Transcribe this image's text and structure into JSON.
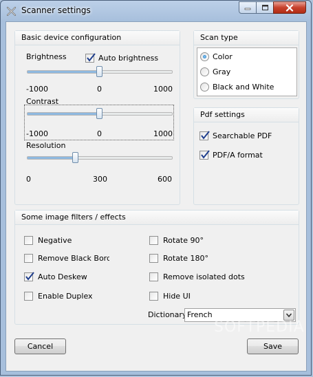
{
  "window": {
    "title": "Scanner settings"
  },
  "basic": {
    "heading": "Basic device configuration",
    "brightness": {
      "label": "Brightness",
      "min": "-1000",
      "mid": "0",
      "max": "1000",
      "value": 0,
      "range": [
        -1000,
        1000
      ]
    },
    "auto_brightness": {
      "label": "Auto brightness",
      "checked": true
    },
    "contrast": {
      "label": "Contrast",
      "min": "-1000",
      "mid": "0",
      "max": "1000",
      "value": 0,
      "range": [
        -1000,
        1000
      ]
    },
    "resolution": {
      "label": "Resolution",
      "min": "0",
      "mid": "300",
      "max": "600",
      "value": 200,
      "range": [
        0,
        600
      ]
    }
  },
  "scan_type": {
    "heading": "Scan type",
    "options": [
      {
        "label": "Color",
        "selected": true
      },
      {
        "label": "Gray",
        "selected": false
      },
      {
        "label": "Black and White",
        "selected": false
      }
    ]
  },
  "pdf": {
    "heading": "Pdf settings",
    "options": [
      {
        "label": "Searchable PDF",
        "checked": true
      },
      {
        "label": "PDF/A format",
        "checked": true
      }
    ]
  },
  "filters": {
    "heading": "Some image filters / effects",
    "left": [
      {
        "label": "Negative",
        "checked": false
      },
      {
        "label": "Remove Black Border:",
        "checked": false
      },
      {
        "label": "Auto Deskew",
        "checked": true
      },
      {
        "label": "Enable Duplex",
        "checked": false
      }
    ],
    "right": [
      {
        "label": "Rotate 90°",
        "checked": false
      },
      {
        "label": "Rotate 180°",
        "checked": false
      },
      {
        "label": "Remove isolated dots",
        "checked": false
      },
      {
        "label": "Hide UI",
        "checked": false
      }
    ],
    "dictionary": {
      "label": "Dictionary",
      "value": "French"
    }
  },
  "buttons": {
    "cancel": "Cancel",
    "save": "Save"
  },
  "watermark": "SOFTPEDIA",
  "colors": {
    "accent": "#8fb9e0",
    "check": "#1f3e8c"
  },
  "icons": {
    "app": "scanner-tools-icon",
    "minimize": "minimize-icon",
    "maximize": "maximize-icon",
    "close": "close-icon",
    "dropdown": "chevron-down-icon"
  }
}
